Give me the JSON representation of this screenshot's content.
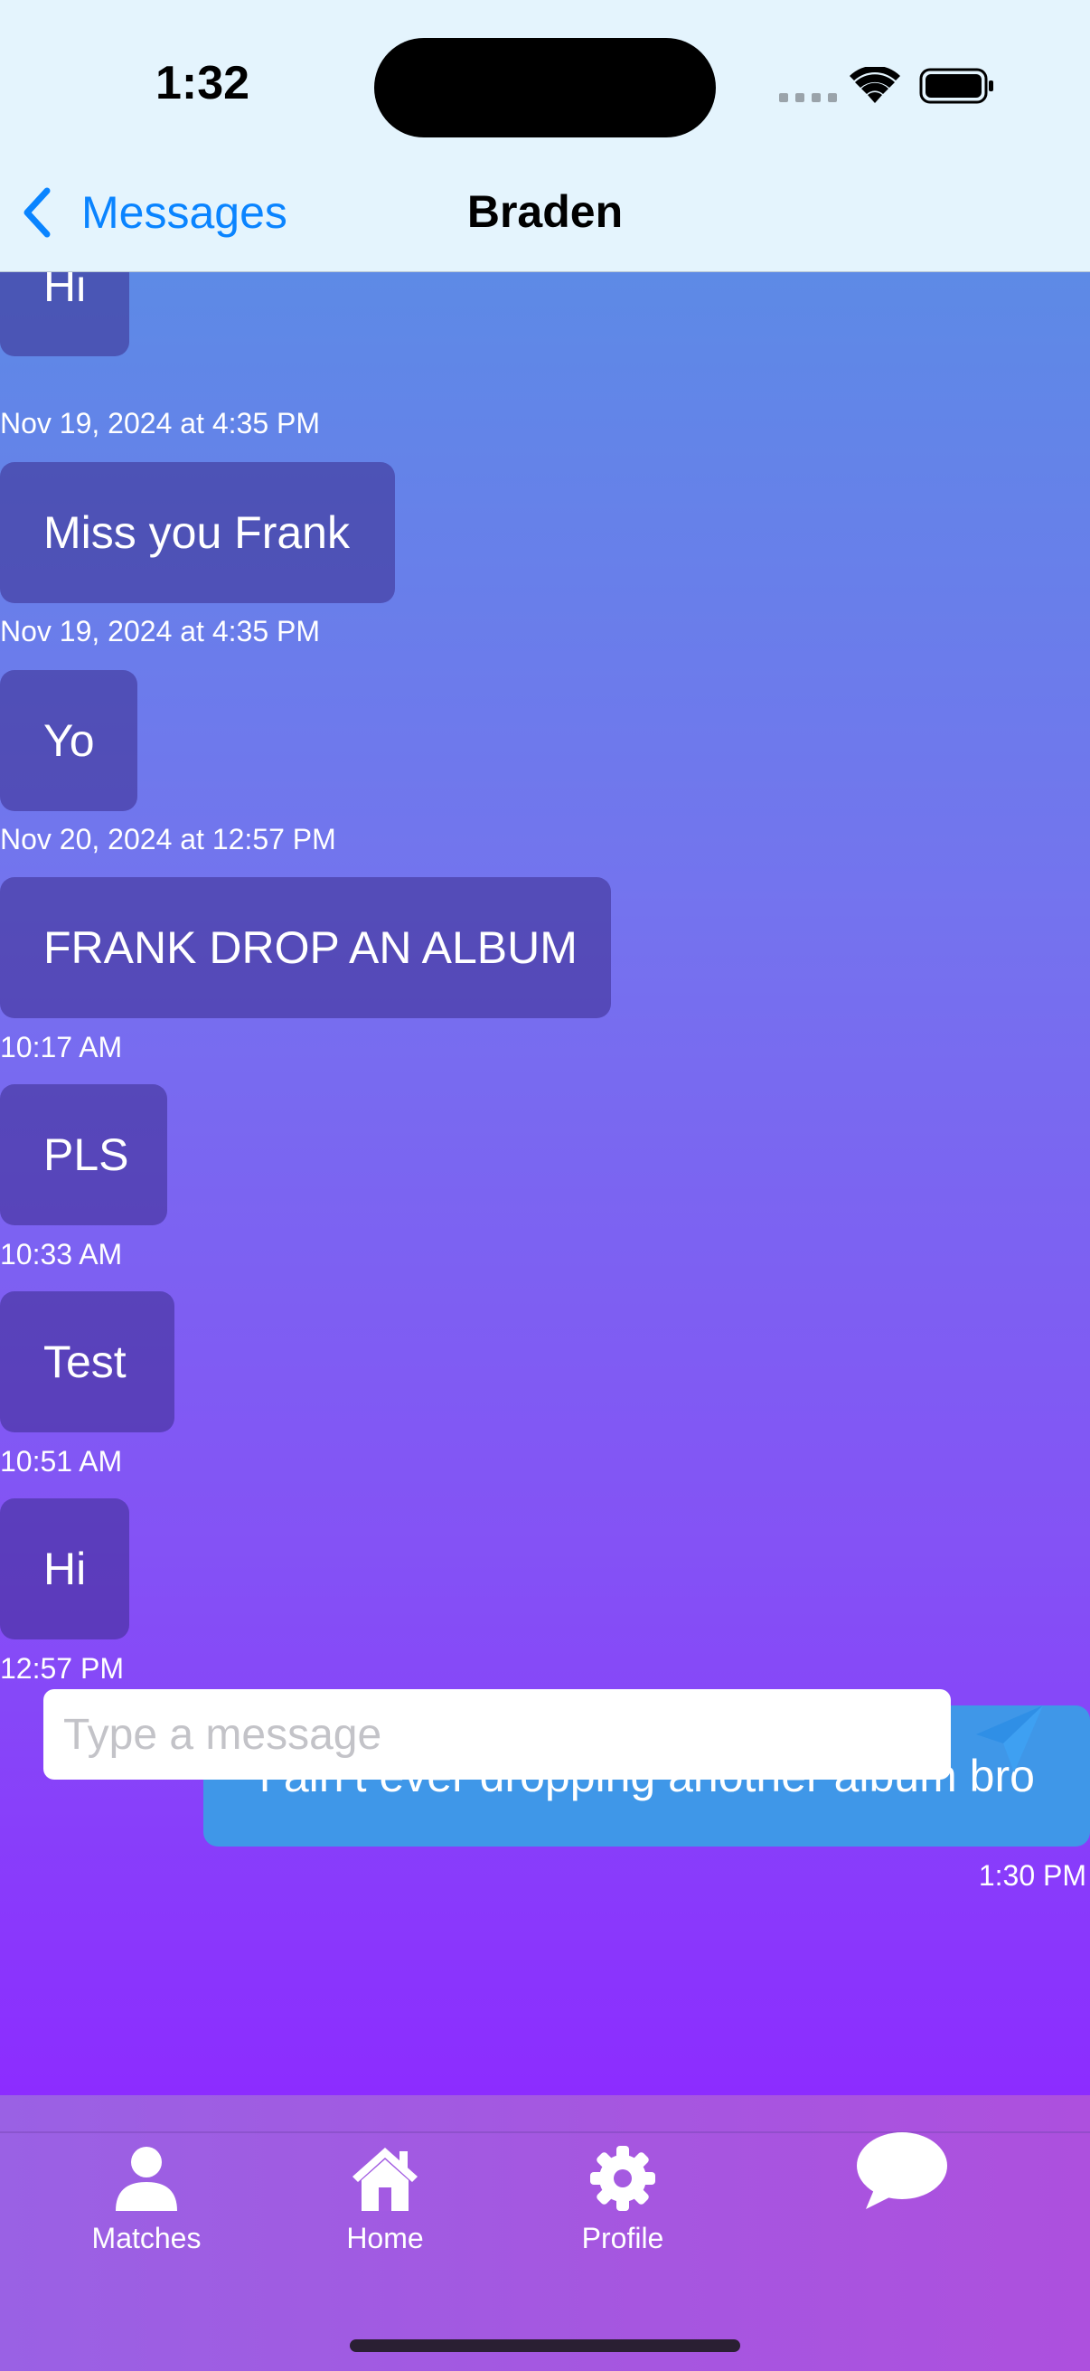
{
  "status_bar": {
    "time": "1:32"
  },
  "nav": {
    "back_label": "Messages",
    "title": "Braden"
  },
  "messages": [
    {
      "text": "Hi",
      "timestamp": "Nov 19, 2024 at 4:35 PM",
      "direction": "incoming"
    },
    {
      "text": "Miss you Frank",
      "timestamp": "Nov 19, 2024 at 4:35 PM",
      "direction": "incoming"
    },
    {
      "text": "Yo",
      "timestamp": "Nov 20, 2024 at 12:57 PM",
      "direction": "incoming"
    },
    {
      "text": "FRANK DROP AN ALBUM",
      "timestamp": "10:17 AM",
      "direction": "incoming"
    },
    {
      "text": "PLS",
      "timestamp": "10:33 AM",
      "direction": "incoming"
    },
    {
      "text": "Test",
      "timestamp": "10:51 AM",
      "direction": "incoming"
    },
    {
      "text": "Hi",
      "timestamp": "12:57 PM",
      "direction": "incoming"
    },
    {
      "text": "I ain’t ever dropping another album bro",
      "timestamp": "1:30 PM",
      "direction": "outgoing"
    }
  ],
  "composer": {
    "placeholder": "Type a message",
    "value": ""
  },
  "tabs": [
    {
      "label": "Matches",
      "icon": "person-icon"
    },
    {
      "label": "Home",
      "icon": "house-icon"
    },
    {
      "label": "Profile",
      "icon": "gear-icon"
    },
    {
      "label": "",
      "icon": "chat-bubble-icon",
      "selected": true
    }
  ],
  "colors": {
    "accent": "#0a84ff",
    "outgoing_bubble": "#3f97e8",
    "gradient_top": "#5d8ae6",
    "gradient_bottom": "#8c2cff"
  }
}
